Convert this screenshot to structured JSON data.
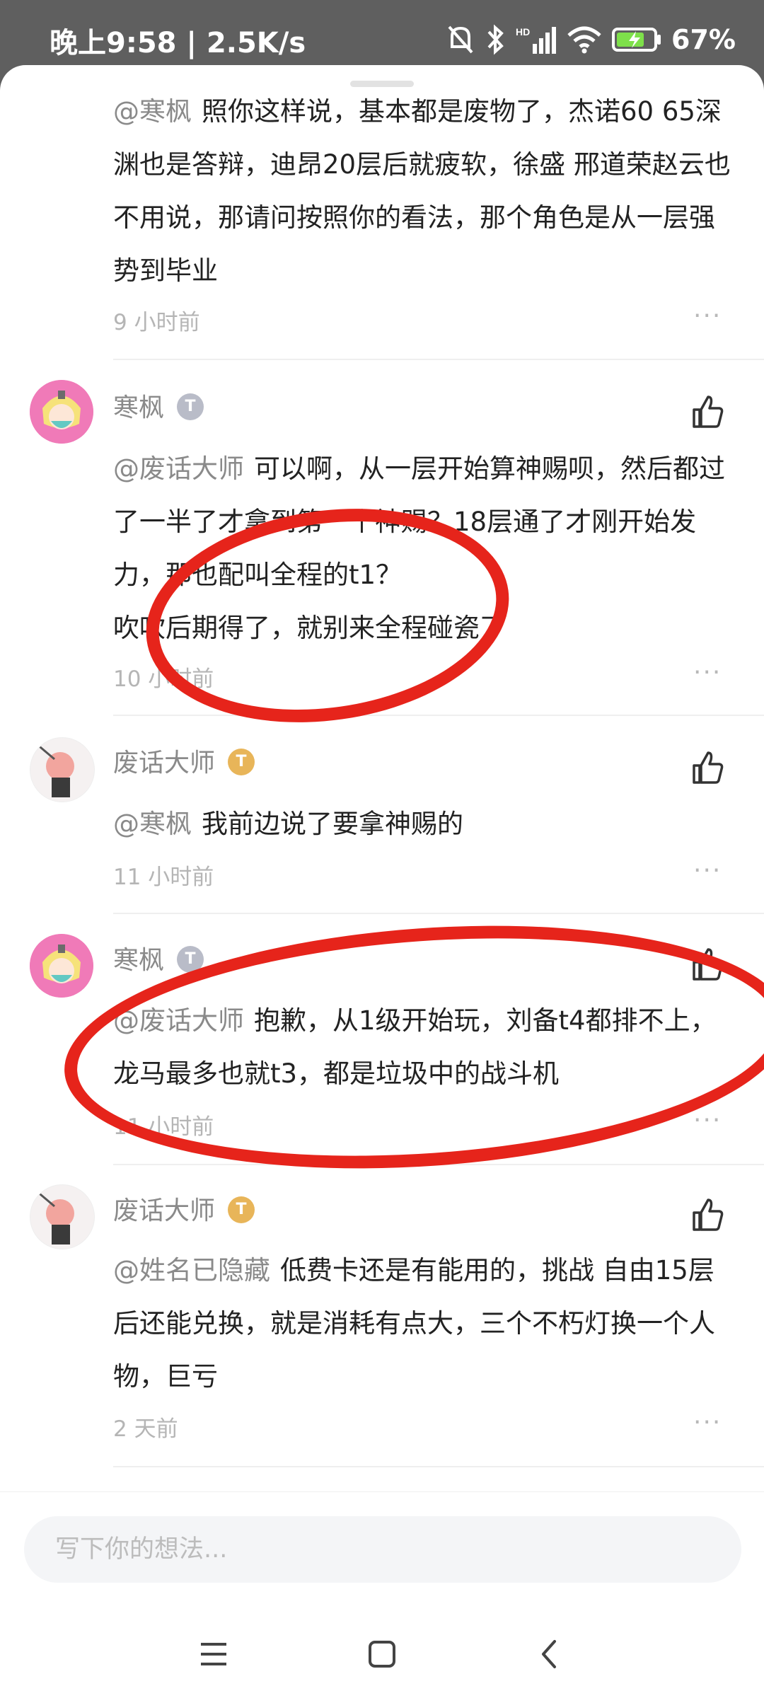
{
  "status_bar": {
    "time_speed": "晚上9:58 | 2.5K/s",
    "battery_text": "67%"
  },
  "comments": [
    {
      "mention": "@寒枫",
      "text": "照你这样说，基本都是废物了，杰诺60 65深渊也是答辩，迪昂20层后就疲软，徐盛 邢道荣赵云也不用说，那请问按照你的看法，那个角色是从一层强势到毕业",
      "time": "9 小时前"
    },
    {
      "username": "寒枫",
      "badge": "T",
      "mention": "@废话大师",
      "text": "可以啊，从一层开始算神赐呗，然后都过了一半了才拿到第一个神赐？18层通了才刚开始发力，那也配叫全程的t1？",
      "text2": "吹吹后期得了，就别来全程碰瓷了",
      "time": "10 小时前"
    },
    {
      "username": "废话大师",
      "badge": "T",
      "mention": "@寒枫",
      "text": "我前边说了要拿神赐的",
      "time": "11 小时前"
    },
    {
      "username": "寒枫",
      "badge": "T",
      "mention": "@废话大师",
      "text": "抱歉，从1级开始玩，刘备t4都排不上，龙马最多也就t3，都是垃圾中的战斗机",
      "time": "11 小时前"
    },
    {
      "username": "废话大师",
      "badge": "T",
      "mention": "@姓名已隐藏",
      "text": "低费卡还是有能用的，挑战 自由15层后还能兑换，就是消耗有点大，三个不朽灯换一个人物，巨亏",
      "time": "2 天前"
    }
  ],
  "more_symbol": "···",
  "input": {
    "placeholder": "写下你的想法..."
  },
  "colors": {
    "annotation_red": "#e6241b",
    "muted_text": "#8a8a8a"
  }
}
